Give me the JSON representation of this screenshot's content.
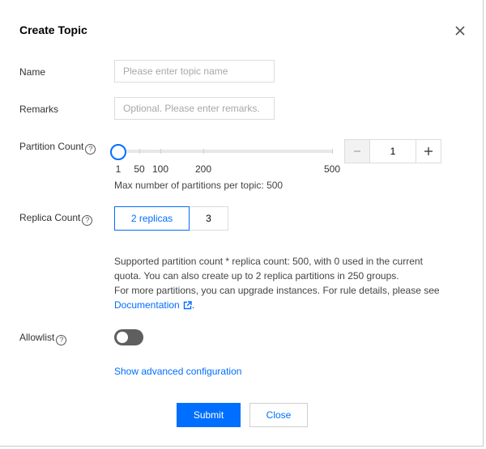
{
  "dialog": {
    "title": "Create Topic"
  },
  "form": {
    "name": {
      "label": "Name",
      "placeholder": "Please enter topic name",
      "value": ""
    },
    "remarks": {
      "label": "Remarks",
      "placeholder": "Optional. Please enter remarks.",
      "value": ""
    },
    "partition_count": {
      "label": "Partition Count",
      "help_icon": "question-circle-icon",
      "value": "1",
      "slider_min": 1,
      "slider_max": 500,
      "slider_value": 1,
      "tick_labels": [
        "1",
        "50",
        "100",
        "200",
        "500"
      ],
      "hint": "Max number of partitions per topic: 500"
    },
    "replica_count": {
      "label": "Replica Count",
      "help_icon": "question-circle-icon",
      "options": [
        "2 replicas",
        "3"
      ],
      "selected": "2 replicas",
      "info_line1": "Supported partition count * replica count: 500, with 0 used in the current",
      "info_line2": "quota. You can also create up to 2 replica partitions in 250 groups.",
      "info_line3": "For more partitions, you can upgrade instances. For rule details, please see",
      "doc_link": "Documentation",
      "doc_suffix": "."
    },
    "allowlist": {
      "label": "Allowlist",
      "help_icon": "question-circle-icon",
      "enabled": false
    },
    "advanced_link": "Show advanced configuration"
  },
  "footer": {
    "submit_label": "Submit",
    "close_label": "Close"
  },
  "colors": {
    "accent": "#006eff",
    "toggle_off": "#5f5f5f"
  }
}
